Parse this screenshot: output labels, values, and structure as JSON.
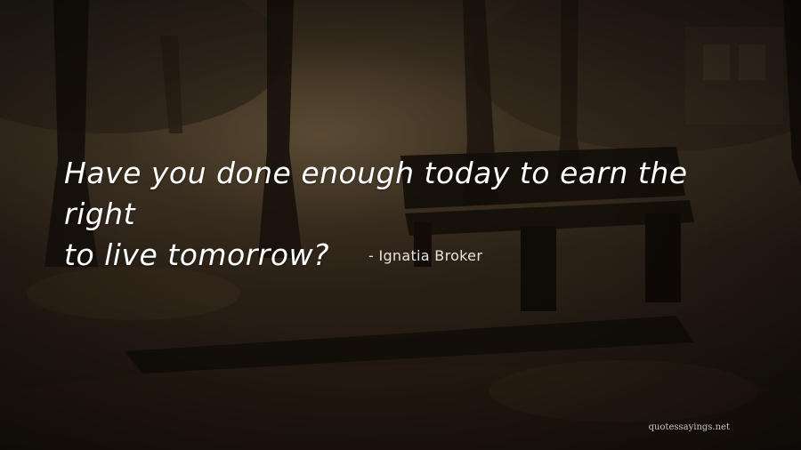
{
  "quote": {
    "line1": "Have you done enough today to earn the right",
    "line2": "to live tomorrow?"
  },
  "author": "- Ignatia Broker",
  "watermark": "quotessayings.net",
  "colors": {
    "text": "#ffffff",
    "background_dark": "#1a130d",
    "background_mid": "#3b3022"
  }
}
